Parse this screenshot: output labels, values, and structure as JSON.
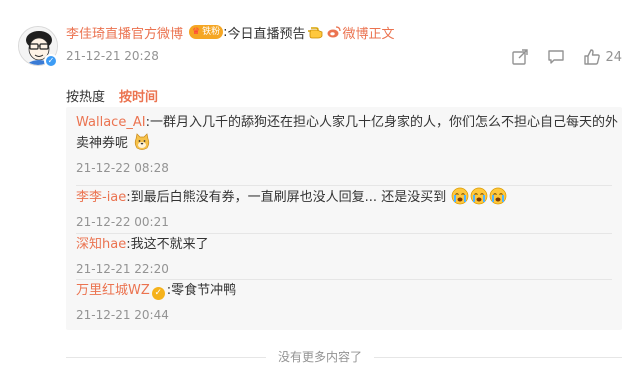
{
  "post": {
    "author": "李佳琦直播官方微博",
    "vip_badge": "铁粉",
    "colon": ":",
    "text": "今日直播预告",
    "link_text": "微博正文",
    "date": "21-12-21 20:28",
    "like_count": "24",
    "icons": {
      "avatar": "avatar-cartoon",
      "verified": "blue-verified-badge",
      "hand": "pointing-hand-icon",
      "weibo": "weibo-logo-icon",
      "share": "share-icon",
      "comment": "comment-icon",
      "like": "like-icon"
    }
  },
  "sort": {
    "hot_label": "按热度",
    "time_label": "按时间"
  },
  "comments": [
    {
      "name": "Wallace_AI",
      "text_line1": ":一群月入几千的舔狗还在担心人家几十亿身家的人，你们怎么不担心自己每天的外",
      "text_line2": "卖神券呢",
      "time": "21-12-22 08:28"
    },
    {
      "name": "李李-iae",
      "text": ":到最后白熊没有券，一直刷屏也没人回复... 还是没买到",
      "time": "21-12-22 00:21"
    },
    {
      "name": "深知hae",
      "text": ":我这不就来了",
      "time": "21-12-21 22:20"
    },
    {
      "name": "万里红城WZ",
      "text": ":零食节冲鸭",
      "time": "21-12-21 20:44"
    }
  ],
  "footer": {
    "no_more": "没有更多内容了"
  },
  "colors": {
    "accent": "#eb7350",
    "muted": "#939393",
    "panel_bg": "#f7f7f7"
  }
}
